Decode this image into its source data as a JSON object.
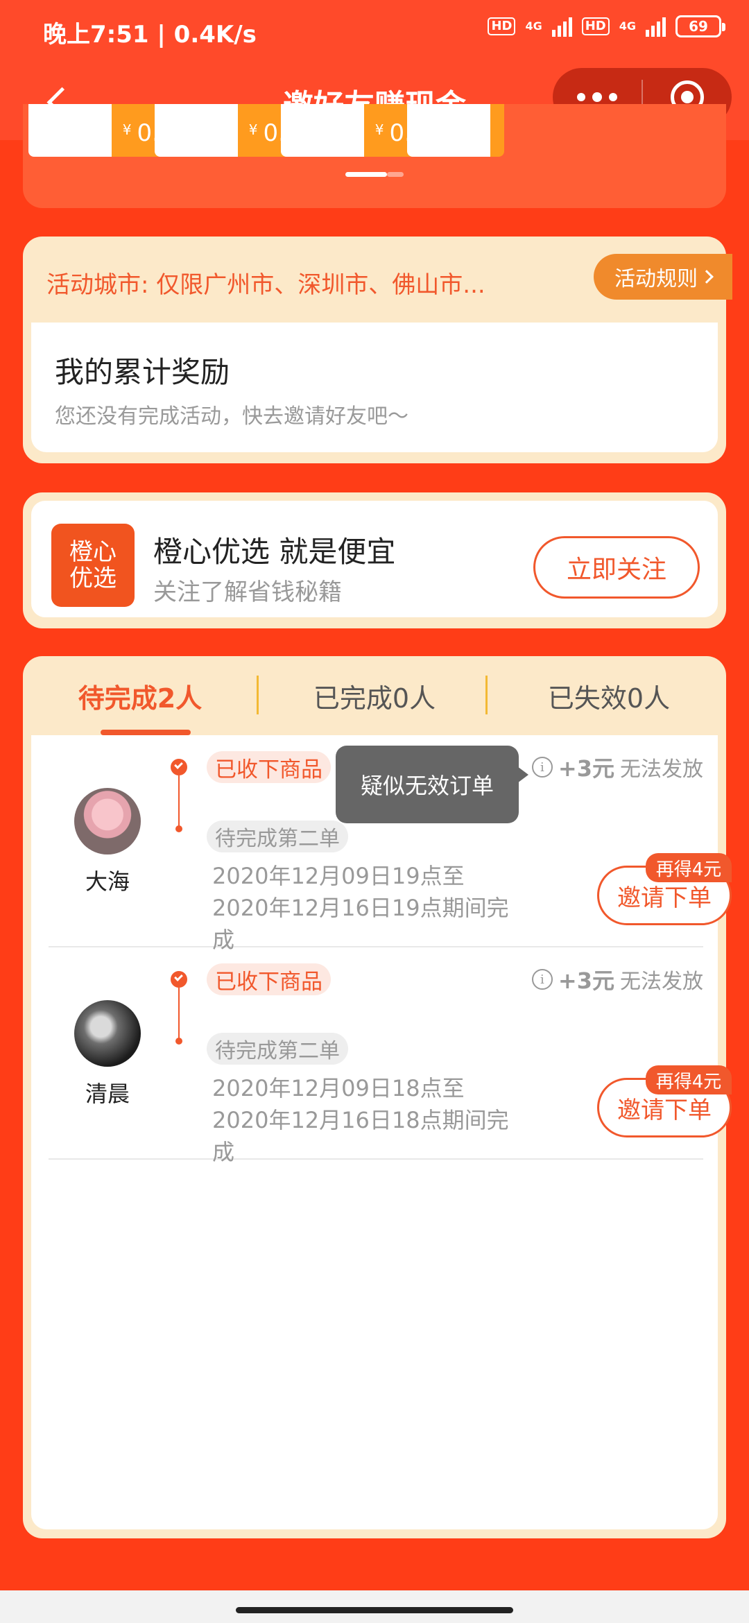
{
  "status_bar": {
    "time": "晚上7:51 | 0.4K/s",
    "hd1": "HD",
    "net1": "4G",
    "hd2": "HD",
    "net2": "4G",
    "battery": "69"
  },
  "title_bar": {
    "title": "邀好友赚现金",
    "back_icon": "chevron-left-icon",
    "more_icon": "more-dots-icon",
    "close_icon": "target-ring-icon"
  },
  "rewards": {
    "items": [
      {
        "currency": "¥",
        "amount": "0.00"
      },
      {
        "currency": "¥",
        "amount": "0.00"
      },
      {
        "currency": "¥",
        "amount": "0.00"
      }
    ]
  },
  "activity": {
    "city_text": "活动城市: 仅限广州市、深圳市、佛山市...",
    "rules_label": "活动规则",
    "accum_title": "我的累计奖励",
    "accum_sub": "您还没有完成活动，快去邀请好友吧～"
  },
  "follow": {
    "logo_line1": "橙心",
    "logo_line2": "优选",
    "title": "橙心优选 就是便宜",
    "subtitle": "关注了解省钱秘籍",
    "button": "立即关注"
  },
  "tabs": [
    {
      "label": "待完成2人",
      "active": true
    },
    {
      "label": "已完成0人",
      "active": false
    },
    {
      "label": "已失效0人",
      "active": false
    }
  ],
  "invitees": [
    {
      "name": "大海",
      "status": "已收下商品",
      "next": "待完成第二单",
      "period": "2020年12月09日19点至2020年12月16日19点期间完成",
      "amount": "+3元",
      "issue": "无法发放",
      "badge": "再得4元",
      "button": "邀请下单"
    },
    {
      "name": "清晨",
      "status": "已收下商品",
      "next": "待完成第二单",
      "period": "2020年12月09日18点至2020年12月16日18点期间完成",
      "amount": "+3元",
      "issue": "无法发放",
      "badge": "再得4元",
      "button": "邀请下单"
    }
  ],
  "tooltip": "疑似无效订单",
  "colors": {
    "primary": "#F1582C",
    "background": "#FF3D17",
    "card": "#FCE9C9"
  }
}
